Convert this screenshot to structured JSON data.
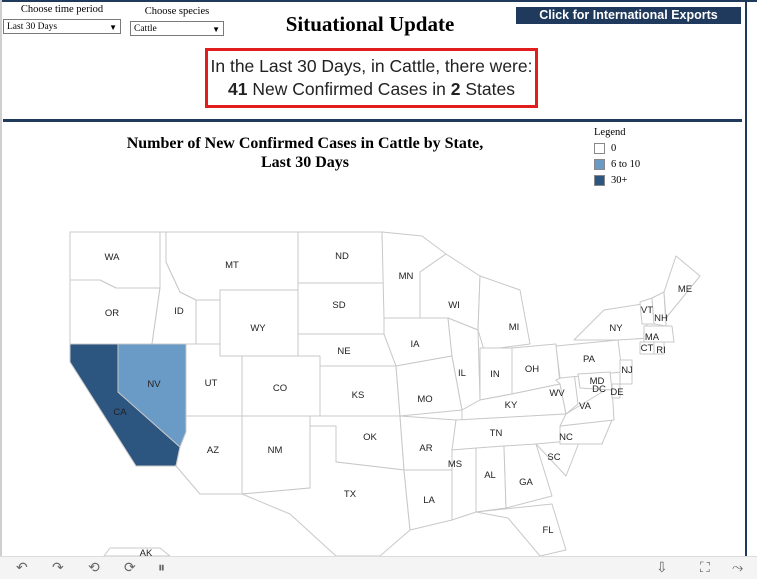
{
  "filters": {
    "time_period": {
      "label": "Choose time period",
      "value": "Last 30 Days"
    },
    "species": {
      "label": "Choose species",
      "value": "Cattle"
    }
  },
  "title": "Situational Update",
  "export_button": "Click for International Exports",
  "summary": {
    "line1": "In the Last 30 Days, in Cattle, there were:",
    "count": "41",
    "mid": " New Confirmed Cases in ",
    "states": "2",
    "end": " States"
  },
  "map": {
    "title_line1": "Number of New Confirmed Cases in Cattle by State,",
    "title_line2": "Last 30 Days",
    "colors": {
      "none": "#ffffff",
      "mid": "#6a9ac6",
      "high": "#2c5580",
      "border": "#c8c8c8"
    },
    "states": {
      "WA": "WA",
      "OR": "OR",
      "CA": "CA",
      "NV": "NV",
      "ID": "ID",
      "MT": "MT",
      "WY": "WY",
      "UT": "UT",
      "AZ": "AZ",
      "CO": "CO",
      "NM": "NM",
      "ND": "ND",
      "SD": "SD",
      "NE": "NE",
      "KS": "KS",
      "OK": "OK",
      "TX": "TX",
      "MN": "MN",
      "IA": "IA",
      "MO": "MO",
      "AR": "AR",
      "LA": "LA",
      "WI": "WI",
      "IL": "IL",
      "MI": "MI",
      "IN": "IN",
      "OH": "OH",
      "KY": "KY",
      "TN": "TN",
      "MS": "MS",
      "AL": "AL",
      "GA": "GA",
      "FL": "FL",
      "SC": "SC",
      "NC": "NC",
      "VA": "VA",
      "WV": "WV",
      "PA": "PA",
      "NY": "NY",
      "VT": "VT",
      "NH": "NH",
      "ME": "ME",
      "MA": "MA",
      "CT": "CT",
      "RI": "RI",
      "NJ": "NJ",
      "DE": "DE",
      "MD": "MD",
      "DC": "DC",
      "AK": "AK"
    }
  },
  "legend": {
    "title": "Legend",
    "items": [
      {
        "label": "0",
        "color": "#ffffff"
      },
      {
        "label": "6 to 10",
        "color": "#6a9ac6"
      },
      {
        "label": "30+",
        "color": "#2c5580"
      }
    ]
  },
  "toolbar": {
    "undo_icon": "↶",
    "redo_icon": "↷",
    "revert_icon": "⟲",
    "refresh_icon": "⟳",
    "pause_icon": "⏸",
    "download_icon": "⇩",
    "fullscreen_icon": "⛶",
    "share_icon": "⤳"
  }
}
